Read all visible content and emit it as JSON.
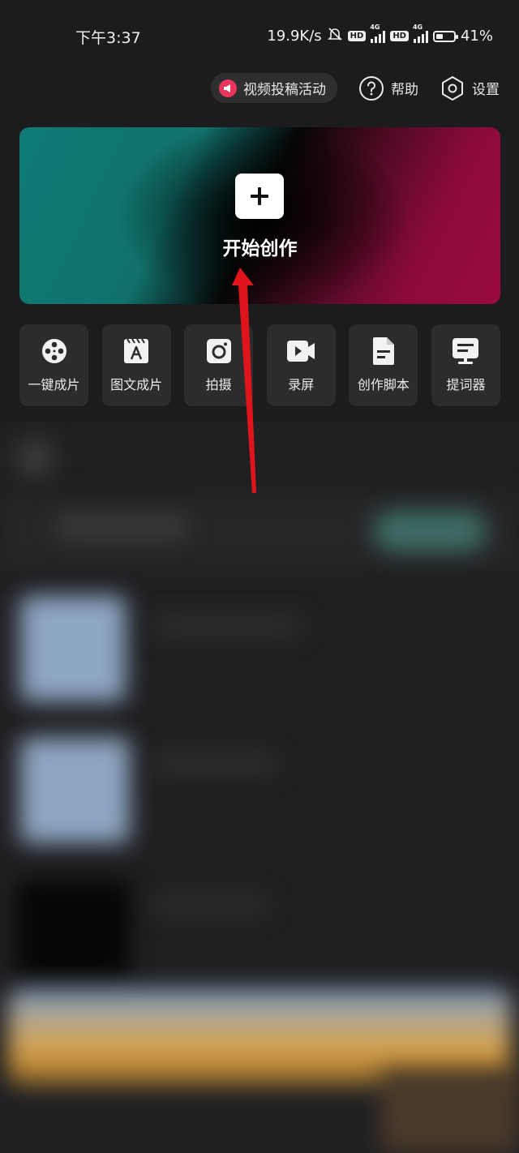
{
  "status_bar": {
    "time": "下午3:37",
    "net_speed": "19.9K/s",
    "hd1": "HD",
    "net1": "4G",
    "hd2": "HD",
    "net2": "4G",
    "battery": "41%",
    "battery_level": 0.41
  },
  "topbar": {
    "promo_label": "视频投稿活动",
    "help_label": "帮助",
    "settings_label": "设置"
  },
  "hero": {
    "title": "开始创作",
    "icon": "plus-icon"
  },
  "tools": [
    {
      "label": "一键成片",
      "icon": "film-reel-icon"
    },
    {
      "label": "图文成片",
      "icon": "text-image-icon"
    },
    {
      "label": "拍摄",
      "icon": "camera-icon"
    },
    {
      "label": "录屏",
      "icon": "screen-record-icon"
    },
    {
      "label": "创作脚本",
      "icon": "script-doc-icon"
    },
    {
      "label": "提词器",
      "icon": "teleprompter-icon"
    }
  ],
  "colors": {
    "background": "#1c1c1e",
    "tile": "#2c2c2e",
    "promo_accent": "#e8365d",
    "annotation_arrow": "#e0141c"
  }
}
